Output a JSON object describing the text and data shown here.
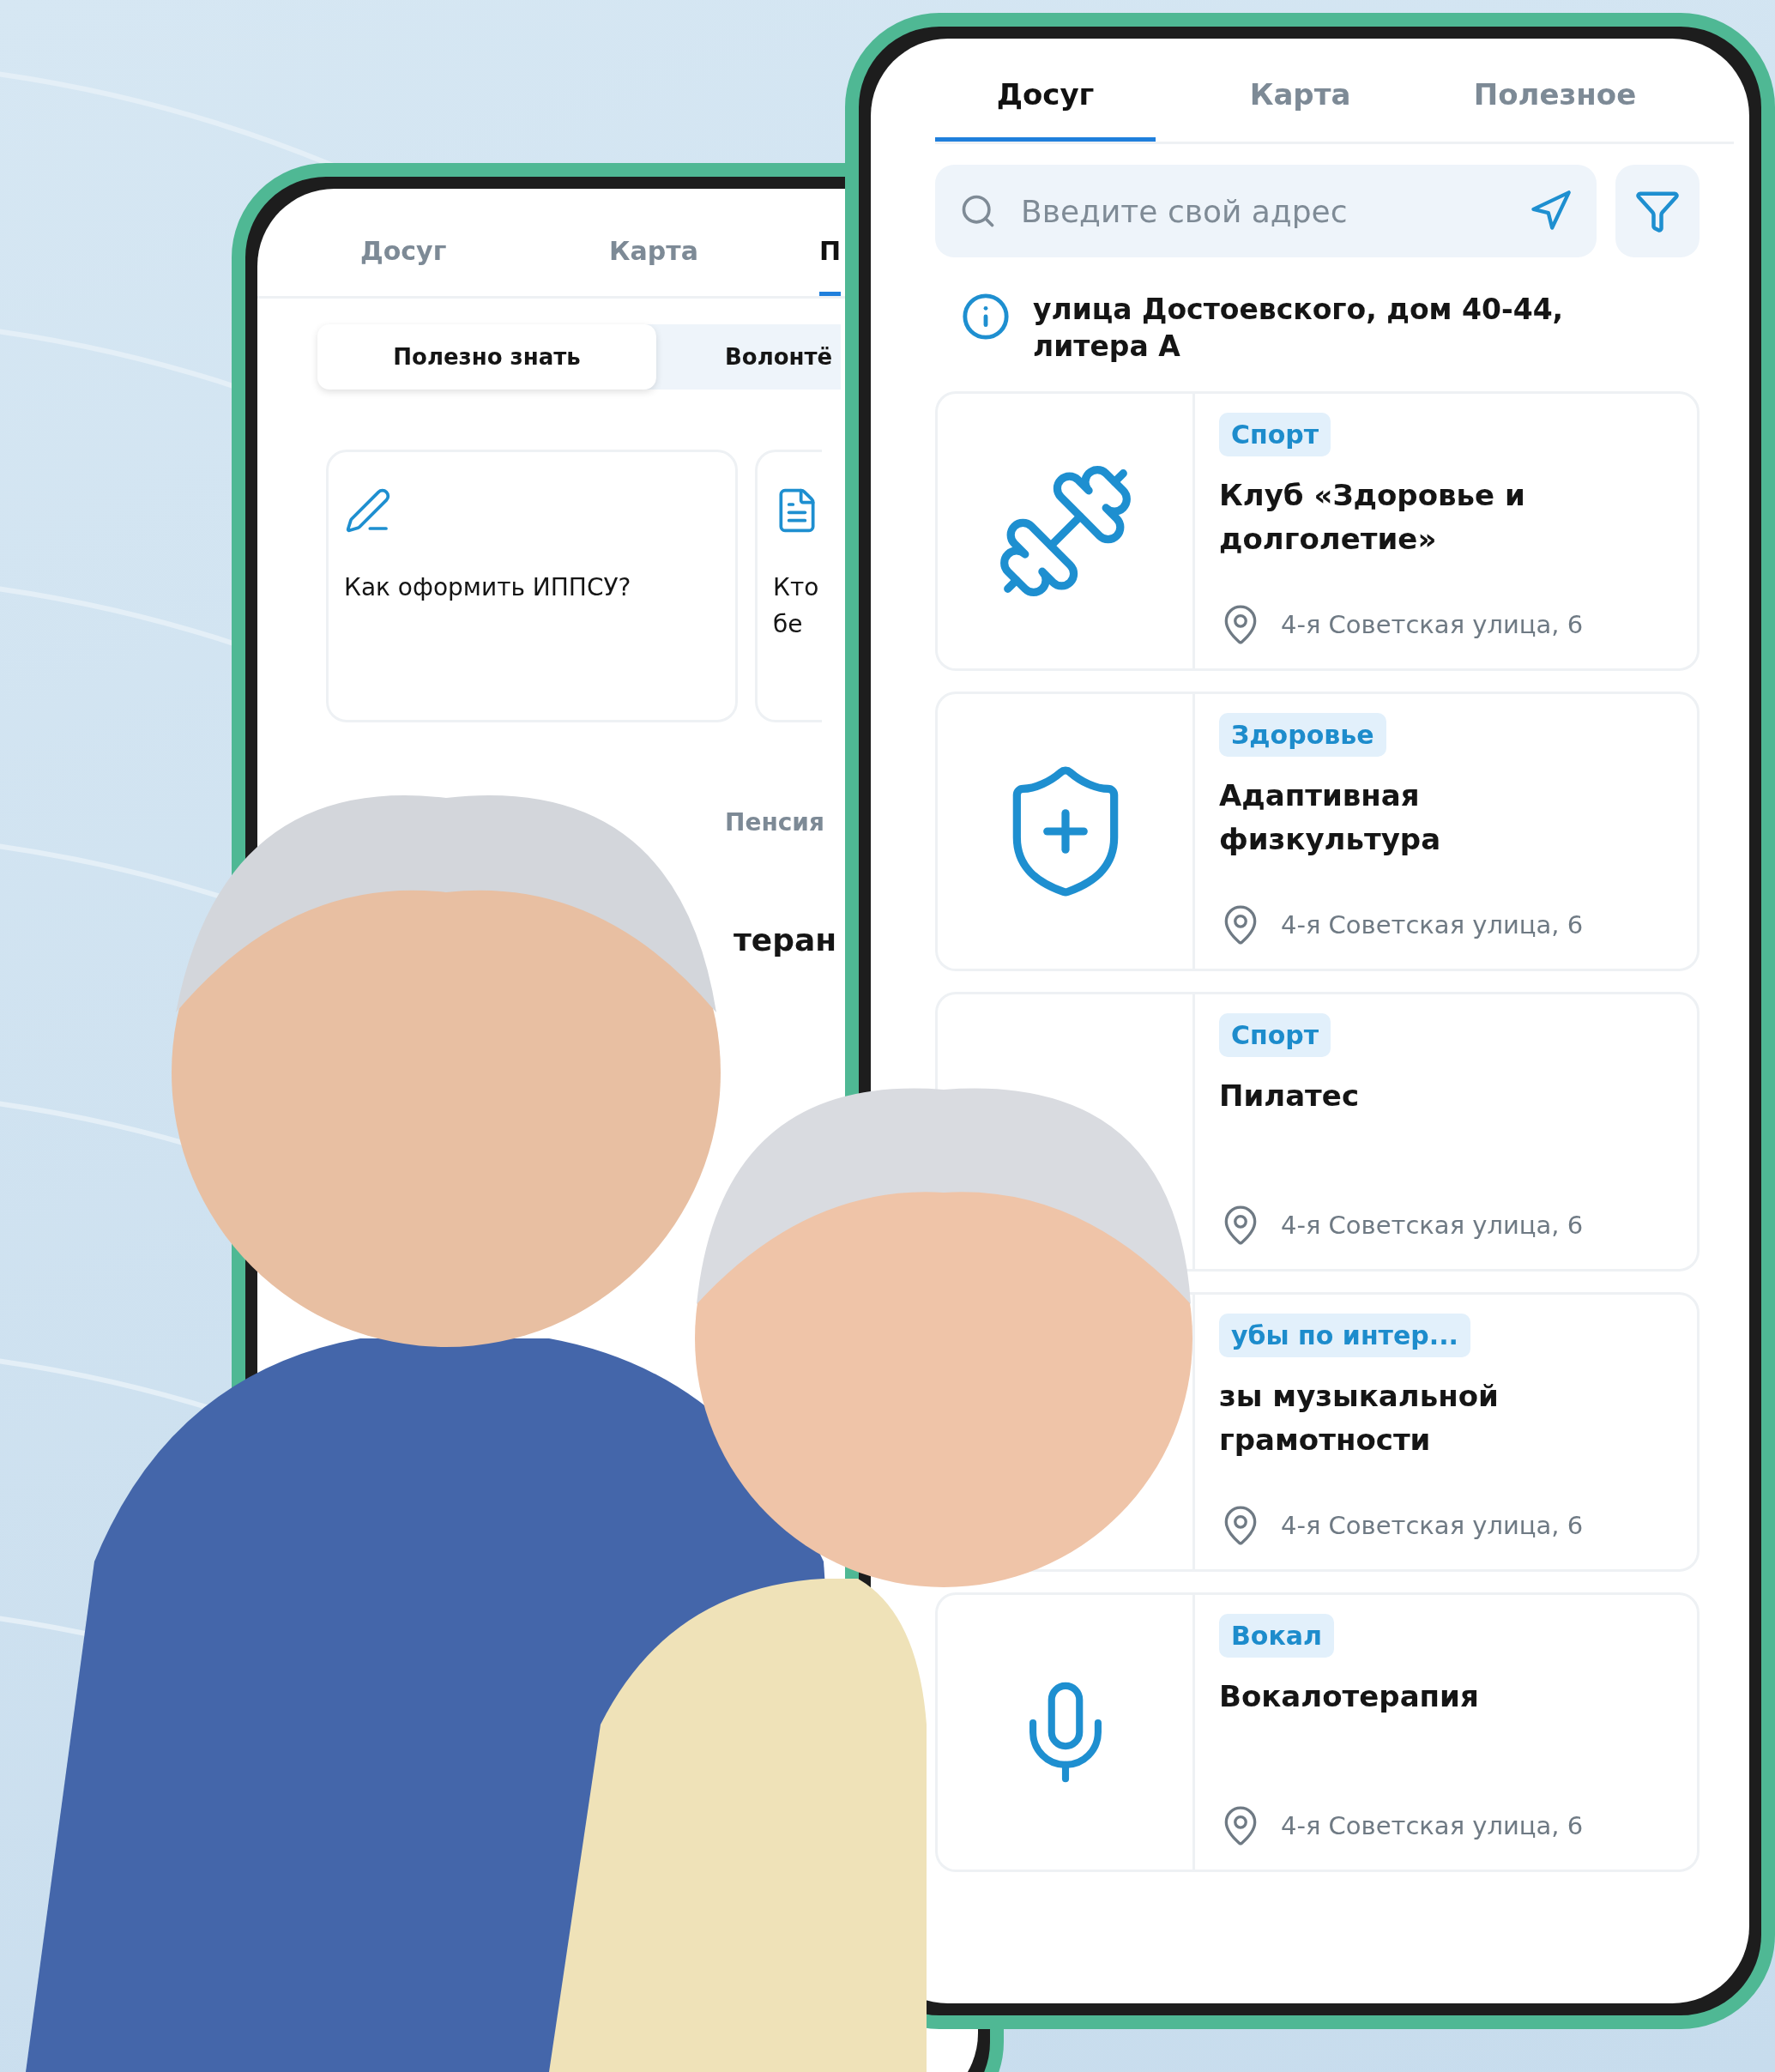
{
  "back_phone": {
    "tabs": [
      {
        "label": "Досуг",
        "selected": false
      },
      {
        "label": "Карта",
        "selected": false
      },
      {
        "label": "П",
        "selected": true
      }
    ],
    "segments": [
      {
        "label": "Полезно знать",
        "selected": true
      },
      {
        "label": "Волонтё",
        "selected": false
      }
    ],
    "cards": [
      {
        "kind": "pen",
        "lines": [
          "Как оформить ИППСУ?"
        ]
      },
      {
        "kind": "document",
        "lines": [
          "Кто",
          "бе"
        ]
      }
    ],
    "section_tab": "Пенсия",
    "article_fragment": "теран"
  },
  "front_phone": {
    "tabs": [
      {
        "label": "Досуг",
        "selected": true
      },
      {
        "label": "Карта",
        "selected": false
      },
      {
        "label": "Полезное",
        "selected": false
      }
    ],
    "search": {
      "placeholder": "Введите свой адрес"
    },
    "address": "улица Достоевского, дом 40-44, литера А",
    "cards": [
      {
        "kind": "dumbbell",
        "tag": "Спорт",
        "title": "Клуб «Здоровье и долголетие»",
        "address": "4-я Советская улица, 6"
      },
      {
        "kind": "shield",
        "tag": "Здоровье",
        "title": "Адаптивная физкультура",
        "address": "4-я Советская улица, 6"
      },
      {
        "kind": "none",
        "tag": "Спорт",
        "title": "Пилатес",
        "address": "4-я Советская улица, 6"
      },
      {
        "kind": "none",
        "tag": "убы по интер...",
        "title": "зы музыкальной грамотности",
        "address": "4-я Советская улица, 6"
      },
      {
        "kind": "microphone",
        "tag": "Вокал",
        "title": "Вокалотерапия",
        "address": "4-я Советская улица, 6"
      }
    ]
  }
}
